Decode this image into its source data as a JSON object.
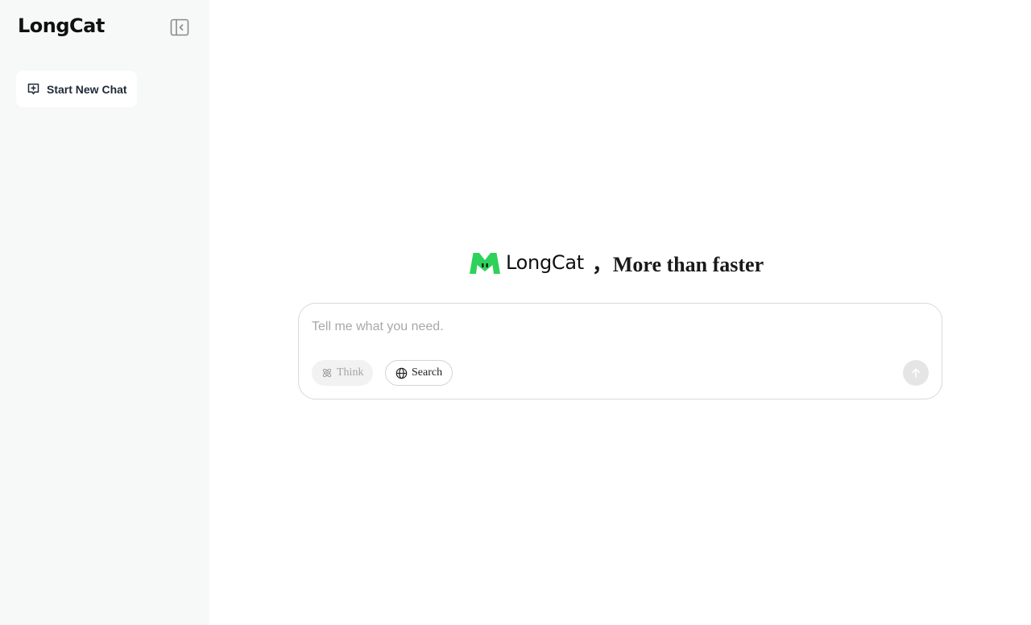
{
  "sidebar": {
    "brand": "LongCat",
    "collapse_icon": "sidebar-collapse-icon",
    "new_chat_label": "Start New Chat",
    "new_chat_icon": "new-chat-icon"
  },
  "hero": {
    "brand": "LongCat",
    "tagline": "，More than faster",
    "logo_color": "#2ed15a"
  },
  "composer": {
    "placeholder": "Tell me what you need.",
    "value": "",
    "think_label": "Think",
    "think_icon": "atom-icon",
    "search_label": "Search",
    "search_icon": "globe-icon",
    "send_icon": "arrow-up-icon"
  }
}
